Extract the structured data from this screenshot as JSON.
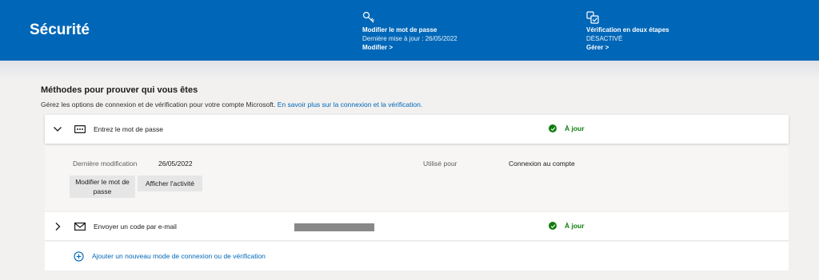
{
  "banner": {
    "title": "Sécurité",
    "password_card": {
      "icon": "key-icon",
      "title": "Modifier le mot de passe",
      "subtitle": "Dernière mise à jour : 26/05/2022",
      "link": "Modifier >"
    },
    "two_step_card": {
      "icon": "two-step-verification-icon",
      "title": "Vérification en deux étapes",
      "subtitle": "DÉSACTIVÉ",
      "link": "Gérer >"
    }
  },
  "section": {
    "title": "Méthodes pour prouver qui vous êtes",
    "description": "Gérez les options de connexion et de vérification pour votre compte Microsoft.",
    "learn_more": "En savoir plus sur la connexion et la vérification."
  },
  "methods": [
    {
      "label": "Entrez le mot de passe",
      "icon": "password-dots-icon",
      "status": "À jour",
      "expanded": true,
      "details": {
        "last_modified_label": "Dernière modification",
        "last_modified_value": "26/05/2022",
        "used_for_label": "Utilisé pour",
        "used_for_value": "Connexion au compte",
        "change_button": "Modifier le mot de passe",
        "activity_button": "Afficher l'activité"
      }
    },
    {
      "label": "Envoyer un code par e-mail",
      "icon": "mail-icon",
      "status": "À jour",
      "expanded": false
    }
  ],
  "add_method": "Ajouter un nouveau mode de connexion ou de vérification",
  "colors": {
    "brand_blue": "#0067b8",
    "status_green": "#107c10",
    "page_bg": "#f2f1f0"
  }
}
